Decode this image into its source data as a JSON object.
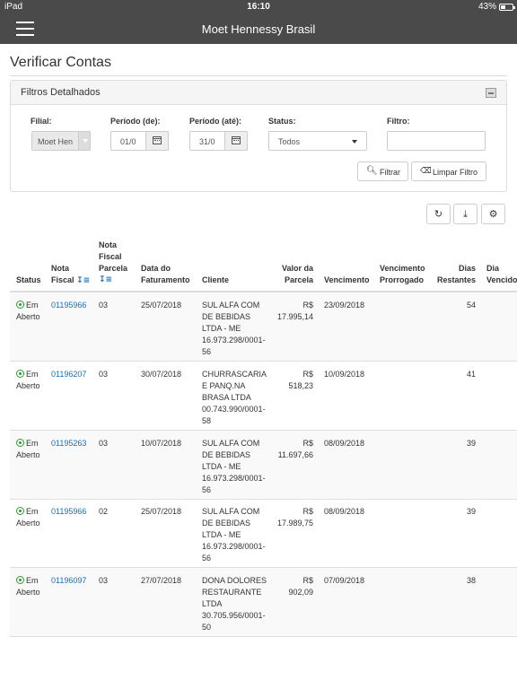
{
  "statusbar": {
    "device": "iPad",
    "time": "16:10",
    "battery": "43%",
    "battery_level": 0.43
  },
  "navbar": {
    "title": "Moet Hennessy Brasil"
  },
  "page": {
    "title": "Verificar Contas"
  },
  "filters": {
    "title": "Filtros Detalhados",
    "filial_label": "Filial:",
    "filial_value": "Moet Hen",
    "periodo_de_label": "Período (de):",
    "periodo_de_value": "01/0",
    "periodo_ate_label": "Período (até):",
    "periodo_ate_value": "31/0",
    "status_label": "Status:",
    "status_value": "Todos",
    "filtro_label": "Filtro:",
    "filtro_value": "",
    "filter_button": "Filtrar",
    "clear_button": "Limpar Filtro"
  },
  "toolbar": {
    "icons": [
      "refresh-icon",
      "download-icon",
      "gear-icon"
    ]
  },
  "table": {
    "headers": {
      "status": "Status",
      "nota_fiscal_1": "Nota",
      "nota_fiscal_2": "Fiscal",
      "parcela_1": "Nota",
      "parcela_2": "Fiscal",
      "parcela_3": "Parcela",
      "faturamento_1": "Data do",
      "faturamento_2": "Faturamento",
      "cliente": "Cliente",
      "valor_1": "Valor da",
      "valor_2": "Parcela",
      "vencimento": "Vencimento",
      "prorrogado_1": "Vencimento",
      "prorrogado_2": "Prorrogado",
      "dias_rest_1": "Dias",
      "dias_rest_2": "Restantes",
      "dias_venc_1": "Dia",
      "dias_venc_2": "Vencido"
    },
    "rows": [
      {
        "status_1": "Em",
        "status_2": "Aberto",
        "nota": "01195966",
        "parcela": "03",
        "faturamento": "25/07/2018",
        "cliente_1": "SUL ALFA COM",
        "cliente_2": "DE BEBIDAS",
        "cliente_3": "LTDA - ME",
        "cliente_4": "16.973.298/0001-",
        "cliente_5": "56",
        "valor_1": "R$",
        "valor_2": "17.995,14",
        "vencimento": "23/09/2018",
        "dias": "54"
      },
      {
        "status_1": "Em",
        "status_2": "Aberto",
        "nota": "01196207",
        "parcela": "03",
        "faturamento": "30/07/2018",
        "cliente_1": "CHURRASCARIA",
        "cliente_2": "E PANQ.NA",
        "cliente_3": "BRASA LTDA",
        "cliente_4": "00.743.990/0001-",
        "cliente_5": "58",
        "valor_1": "R$",
        "valor_2": "518,23",
        "vencimento": "10/09/2018",
        "dias": "41"
      },
      {
        "status_1": "Em",
        "status_2": "Aberto",
        "nota": "01195263",
        "parcela": "03",
        "faturamento": "10/07/2018",
        "cliente_1": "SUL ALFA COM",
        "cliente_2": "DE BEBIDAS",
        "cliente_3": "LTDA - ME",
        "cliente_4": "16.973.298/0001-",
        "cliente_5": "56",
        "valor_1": "R$",
        "valor_2": "11.697,66",
        "vencimento": "08/09/2018",
        "dias": "39"
      },
      {
        "status_1": "Em",
        "status_2": "Aberto",
        "nota": "01195966",
        "parcela": "02",
        "faturamento": "25/07/2018",
        "cliente_1": "SUL ALFA COM",
        "cliente_2": "DE BEBIDAS",
        "cliente_3": "LTDA - ME",
        "cliente_4": "16.973.298/0001-",
        "cliente_5": "56",
        "valor_1": "R$",
        "valor_2": "17.989,75",
        "vencimento": "08/09/2018",
        "dias": "39"
      },
      {
        "status_1": "Em",
        "status_2": "Aberto",
        "nota": "01196097",
        "parcela": "03",
        "faturamento": "27/07/2018",
        "cliente_1": "DONA DOLORES",
        "cliente_2": "RESTAURANTE",
        "cliente_3": "LTDA",
        "cliente_4": "30.705.956/0001-",
        "cliente_5": "50",
        "valor_1": "R$",
        "valor_2": "902,09",
        "vencimento": "07/09/2018",
        "dias": "38"
      }
    ]
  }
}
